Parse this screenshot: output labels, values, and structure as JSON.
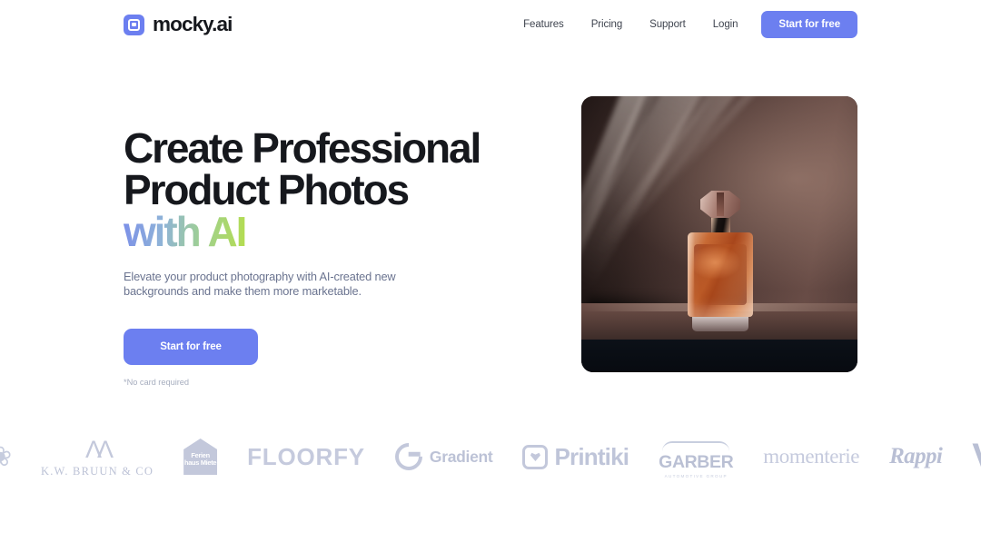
{
  "header": {
    "brand": {
      "name": "mocky.ai",
      "icon": "logo-square-icon",
      "color": "#6c7ff0"
    },
    "nav": [
      {
        "label": "Features"
      },
      {
        "label": "Pricing"
      },
      {
        "label": "Support"
      },
      {
        "label": "Login"
      }
    ],
    "cta": {
      "label": "Start for free"
    }
  },
  "hero": {
    "headline_line1": "Create Professional",
    "headline_line2_plain": "Product Photos ",
    "headline_line2_gradient": "with AI",
    "subhead": "Elevate your product photography with AI-created new backgrounds and make them more marketable.",
    "cta": {
      "label": "Start for free"
    },
    "card_note": "*No card required",
    "image_alt": "perfume-bottle-product-photo"
  },
  "logos": [
    {
      "name": "leaf-logo",
      "text": "❀"
    },
    {
      "name": "kw-bruun-logo",
      "mark": "ΛΛ",
      "text": "K.W. BRUUN & CO"
    },
    {
      "name": "ferienhausmiete-logo",
      "text": "Ferien haus Miete"
    },
    {
      "name": "floorfy-logo",
      "text": "FLOORFY"
    },
    {
      "name": "gradient-logo",
      "text": "Gradient"
    },
    {
      "name": "printiki-logo",
      "text": "Printiki"
    },
    {
      "name": "garber-logo",
      "text": "GARBER",
      "sub": "AUTOMOTIVE GROUP"
    },
    {
      "name": "momenterie-logo",
      "text": "momenterie"
    },
    {
      "name": "rappi-logo",
      "text": "Rappi"
    },
    {
      "name": "v-logo",
      "text": "V"
    }
  ],
  "colors": {
    "accent": "#6c7ff0",
    "text": "#16181d",
    "muted": "#6b7490",
    "logo_gray": "#b9bfd4",
    "gradient_start": "#7b8fe8",
    "gradient_end": "#b4dd4f"
  }
}
